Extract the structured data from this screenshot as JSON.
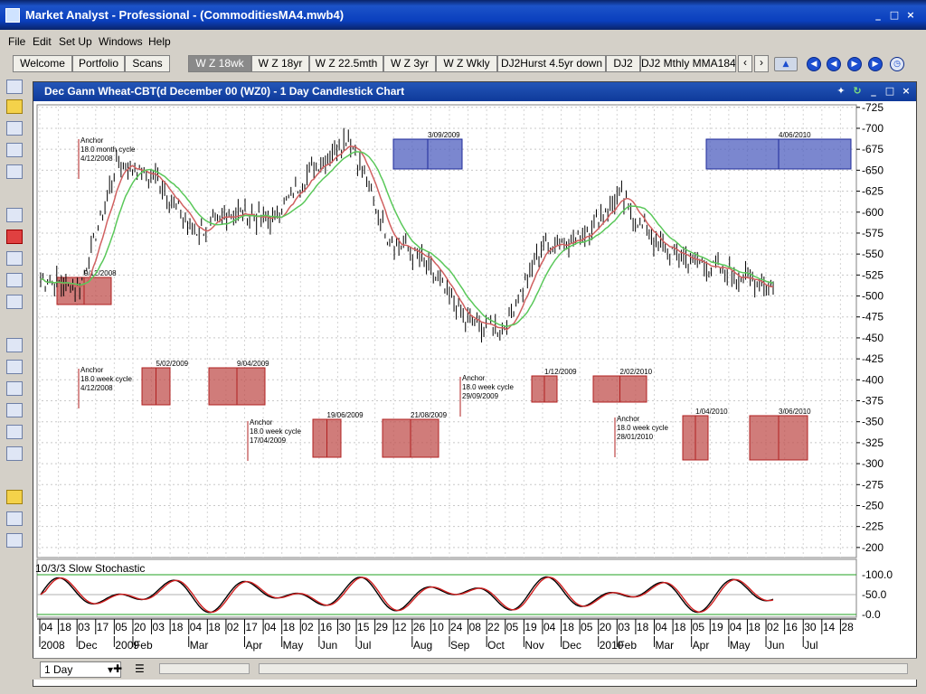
{
  "window": {
    "title": "Market Analyst - Professional - (CommoditiesMA4.mwb4)",
    "minimize": "_",
    "maximize": "□",
    "close": "×"
  },
  "menu": [
    "File",
    "Edit",
    "Set Up",
    "Windows",
    "Help"
  ],
  "tabs": {
    "left": [
      "Welcome",
      "Portfolio",
      "Scans"
    ],
    "charts": [
      "W Z 18wk",
      "W Z 18yr",
      "W Z 22.5mth",
      "W Z 3yr",
      "W Z Wkly",
      "DJ2Hurst 4.5yr down",
      "DJ2",
      "DJ2 Mthly MMA184"
    ],
    "active": "W Z 18wk"
  },
  "chart_window": {
    "title": "Dec Gann Wheat-CBT(d December 00 (WZ0) - 1 Day Candlestick Chart"
  },
  "chart_data": [
    {
      "type": "candlestick",
      "title": "Dec Gann Wheat-CBT(d December 00 (WZ0) - 1 Day Candlestick Chart",
      "ylim": [
        188,
        728
      ],
      "y_ticks": [
        725,
        700,
        675,
        650,
        625,
        600,
        575,
        550,
        525,
        500,
        475,
        450,
        425,
        400,
        375,
        350,
        325,
        300,
        275,
        250,
        225,
        200
      ],
      "grid": true,
      "series": [
        {
          "name": "",
          "kind": "price",
          "x": [
            "2008-10",
            "2008-11",
            "2008-12",
            "2009-01",
            "2009-02",
            "2009-03",
            "2009-04",
            "2009-05",
            "2009-06",
            "2009-07",
            "2009-08",
            "2009-09",
            "2009-10",
            "2009-11",
            "2009-12",
            "2010-01",
            "2010-02",
            "2010-03",
            "2010-04",
            "2010-05"
          ],
          "values": [
            520,
            510,
            660,
            640,
            575,
            600,
            590,
            650,
            690,
            570,
            540,
            470,
            460,
            560,
            570,
            620,
            560,
            540,
            525,
            510
          ]
        }
      ],
      "annotations": [
        {
          "kind": "anchor",
          "text": [
            "Anchor",
            "18.0 month cycle",
            "4/12/2008"
          ]
        },
        {
          "kind": "anchor",
          "text": [
            "Anchor",
            "18.0 week cycle",
            "4/12/2008"
          ]
        },
        {
          "kind": "anchor",
          "text": [
            "Anchor",
            "18.0 week cycle",
            "17/04/2009"
          ]
        },
        {
          "kind": "anchor",
          "text": [
            "Anchor",
            "18.0 week cycle",
            "29/09/2009"
          ]
        },
        {
          "kind": "anchor",
          "text": [
            "Anchor",
            "18.0 week cycle",
            "28/01/2010"
          ]
        },
        {
          "kind": "box",
          "color": "blue",
          "label": "3/09/2009"
        },
        {
          "kind": "box",
          "color": "blue",
          "label": "4/06/2010"
        },
        {
          "kind": "box",
          "color": "red",
          "label": "9/12/2008"
        },
        {
          "kind": "box",
          "color": "red",
          "label": "5/02/2009"
        },
        {
          "kind": "box",
          "color": "red",
          "label": "9/04/2009"
        },
        {
          "kind": "box",
          "color": "red",
          "label": "19/06/2009"
        },
        {
          "kind": "box",
          "color": "red",
          "label": "21/08/2009"
        },
        {
          "kind": "box",
          "color": "red",
          "label": "1/12/2009"
        },
        {
          "kind": "box",
          "color": "red",
          "label": "2/02/2010"
        },
        {
          "kind": "box",
          "color": "red",
          "label": "1/04/2010"
        },
        {
          "kind": "box",
          "color": "red",
          "label": "3/06/2010"
        }
      ]
    },
    {
      "type": "line",
      "title": "10/3/3 Slow Stochastic",
      "ylim": [
        0,
        100
      ],
      "y_ticks": [
        "100.0",
        "50.0",
        "0.0"
      ],
      "series": [
        {
          "name": "",
          "color": "#000000"
        },
        {
          "name": "",
          "color": "#d02020"
        }
      ]
    }
  ],
  "x_axis": {
    "days": [
      "04",
      "18",
      "03",
      "17",
      "05",
      "20",
      "03",
      "18",
      "04",
      "18",
      "02",
      "17",
      "04",
      "18",
      "02",
      "16",
      "30",
      "15",
      "29",
      "12",
      "26",
      "10",
      "24",
      "08",
      "22",
      "05",
      "19",
      "04",
      "18",
      "05",
      "20",
      "03",
      "18",
      "04",
      "18",
      "05",
      "19",
      "04",
      "18",
      "02",
      "16",
      "30",
      "14",
      "28"
    ],
    "months": [
      "2008",
      "Dec",
      "2009",
      "Feb",
      "Mar",
      "Apr",
      "May",
      "Jun",
      "Jul",
      "Aug",
      "Sep",
      "Oct",
      "Nov",
      "Dec",
      "2010",
      "Feb",
      "Mar",
      "Apr",
      "May",
      "Jun",
      "Jul"
    ]
  },
  "bottom": {
    "period": "1 Day"
  },
  "colors": {
    "price": "#000000",
    "ma_green": "#5ac85a",
    "ma_red": "#d06060",
    "box_red": "#c0504d",
    "box_blue": "#4f5fbf"
  }
}
